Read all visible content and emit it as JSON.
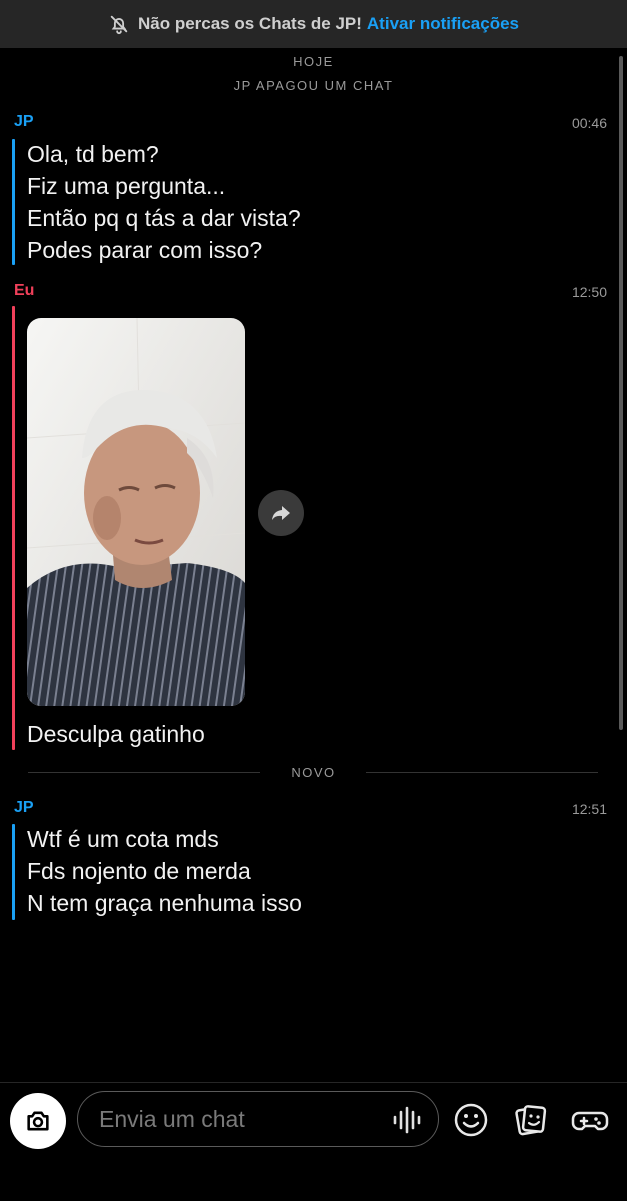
{
  "banner": {
    "text": "Não percas os Chats de JP!",
    "link": "Ativar notificações",
    "icon": "bell-off-icon"
  },
  "labels": {
    "today": "HOJE",
    "deleted": "JP APAGOU UM CHAT",
    "new": "NOVO"
  },
  "messages": [
    {
      "sender": "JP",
      "time": "00:46",
      "lines": [
        "Ola, td bem?",
        "Fiz uma pergunta...",
        "Então pq q tás a dar vista?",
        "Podes parar com isso?"
      ]
    },
    {
      "sender": "Eu",
      "time": "12:50",
      "caption": "Desculpa gatinho"
    },
    {
      "sender": "JP",
      "time": "12:51",
      "lines": [
        "Wtf é um cota mds",
        "Fds nojento de merda",
        "N tem graça nenhuma isso"
      ]
    }
  ],
  "composer": {
    "placeholder": "Envia um chat"
  },
  "icons": {
    "camera": "camera-icon",
    "mic": "voice-icon",
    "emoji": "smiley-icon",
    "stickers": "sticker-icon",
    "games": "gamepad-icon",
    "share": "share-arrow-icon"
  },
  "colors": {
    "jp": "#1aa0f5",
    "me": "#f0405a",
    "background": "#000000"
  }
}
